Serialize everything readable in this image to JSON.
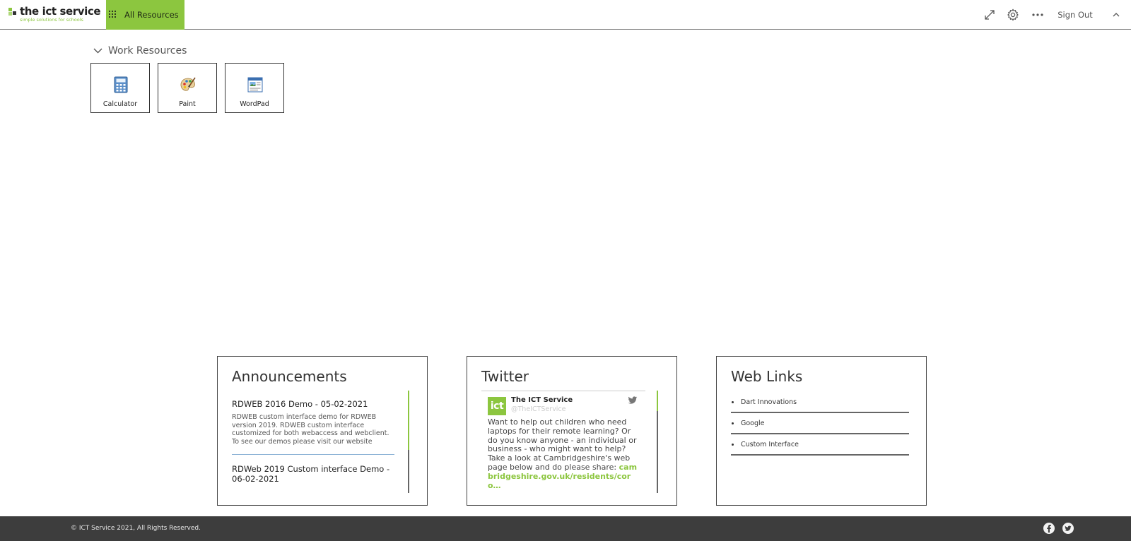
{
  "header": {
    "logo": {
      "title": "the ict service",
      "tagline": "simple solutions for schools"
    },
    "all_resources_label": "All Resources",
    "sign_out_label": "Sign Out",
    "icons": [
      "expand-icon",
      "gear-icon",
      "more-icon",
      "chevron-up-icon"
    ]
  },
  "work_resources": {
    "title": "Work Resources",
    "apps": [
      {
        "label": "Calculator",
        "icon": "calculator-icon"
      },
      {
        "label": "Paint",
        "icon": "paint-palette-icon"
      },
      {
        "label": "WordPad",
        "icon": "wordpad-icon"
      }
    ]
  },
  "announcements": {
    "title": "Announcements",
    "items": [
      {
        "title": "RDWEB 2016 Demo - 05-02-2021",
        "body": "RDWEB custom interface demo for RDWEB version 2019. RDWEB custom interface customized for both webaccess and webclient. To see our demos please visit our website"
      },
      {
        "title": "RDWeb 2019 Custom interface Demo - 06-02-2021",
        "body": ""
      }
    ]
  },
  "twitter": {
    "title": "Twitter",
    "avatar_text": "ict",
    "name": "The ICT Service",
    "handle": "@TheICTService",
    "text": "Want to help out children who need laptops for their remote learning? Or do you know anyone - an individual or business - who might want to help? Take a look at Cambridgeshire's web page below and do please share:",
    "link": "cambridgeshire.gov.uk/residents/coro…"
  },
  "web_links": {
    "title": "Web Links",
    "items": [
      "Dart Innovations",
      "Google",
      "Custom Interface"
    ]
  },
  "footer": {
    "copyright": "© ICT Service 2021, All Rights Reserved."
  },
  "colors": {
    "accent": "#8cc63f",
    "footer_bg": "#3d3d3d"
  }
}
